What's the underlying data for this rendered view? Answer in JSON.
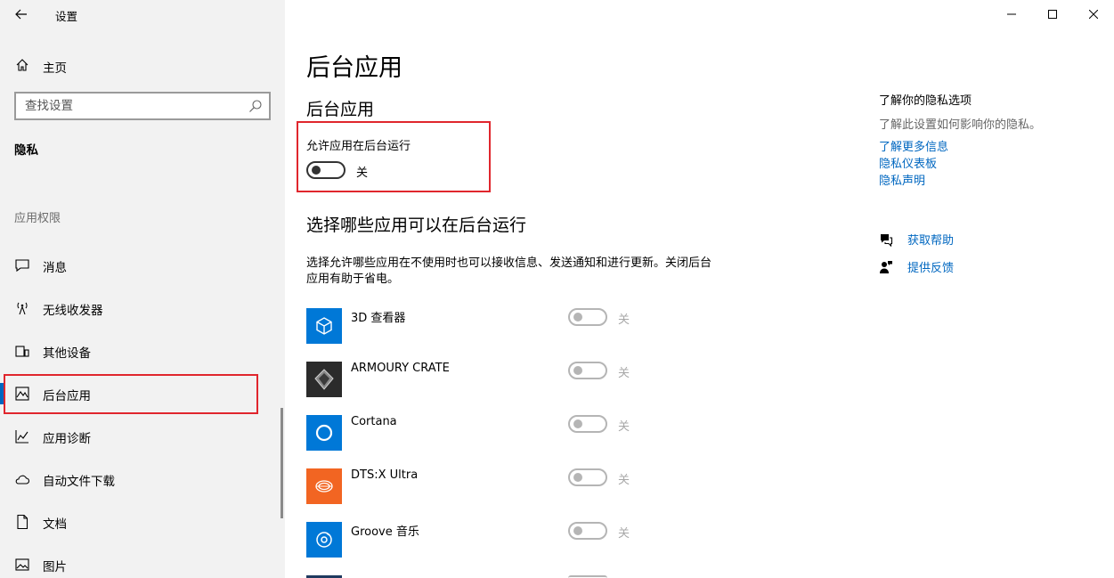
{
  "window": {
    "title": "设置",
    "controls": [
      "minimize",
      "maximize",
      "close"
    ]
  },
  "sidebar": {
    "home_label": "主页",
    "search": {
      "placeholder": "查找设置"
    },
    "section_title": "隐私",
    "group_label": "应用权限",
    "items": [
      {
        "label": "消息",
        "icon": "message-icon"
      },
      {
        "label": "无线收发器",
        "icon": "antenna-icon"
      },
      {
        "label": "其他设备",
        "icon": "devices-icon"
      },
      {
        "label": "后台应用",
        "icon": "background-app-icon",
        "selected": true
      },
      {
        "label": "应用诊断",
        "icon": "diagnostics-icon"
      },
      {
        "label": "自动文件下载",
        "icon": "cloud-icon"
      },
      {
        "label": "文档",
        "icon": "document-icon"
      },
      {
        "label": "图片",
        "icon": "picture-icon"
      }
    ]
  },
  "main": {
    "page_title": "后台应用",
    "subtitle": "后台应用",
    "allow_label": "允许应用在后台运行",
    "allow_state": "关",
    "choose_title": "选择哪些应用可以在后台运行",
    "description": "选择允许哪些应用在不使用时也可以接收信息、发送通知和进行更新。关闭后台应用有助于省电。",
    "apps": [
      {
        "name": "3D 查看器",
        "state": "关",
        "color": "#0078d7"
      },
      {
        "name": "ARMOURY CRATE",
        "state": "关",
        "color": "#2b2b2b"
      },
      {
        "name": "Cortana",
        "state": "关",
        "color": "#0078d7"
      },
      {
        "name": "DTS:X Ultra",
        "state": "关",
        "color": "#f26522"
      },
      {
        "name": "Groove 音乐",
        "state": "关",
        "color": "#0078d7"
      }
    ]
  },
  "right_panel": {
    "heading": "了解你的隐私选项",
    "text": "了解此设置如何影响你的隐私。",
    "links": [
      "了解更多信息",
      "隐私仪表板",
      "隐私声明"
    ],
    "help_label": "获取帮助",
    "feedback_label": "提供反馈"
  },
  "colors": {
    "accent": "#0067c0",
    "highlight_box": "#e0262d",
    "sidebar_bg": "#f2f2f2"
  }
}
